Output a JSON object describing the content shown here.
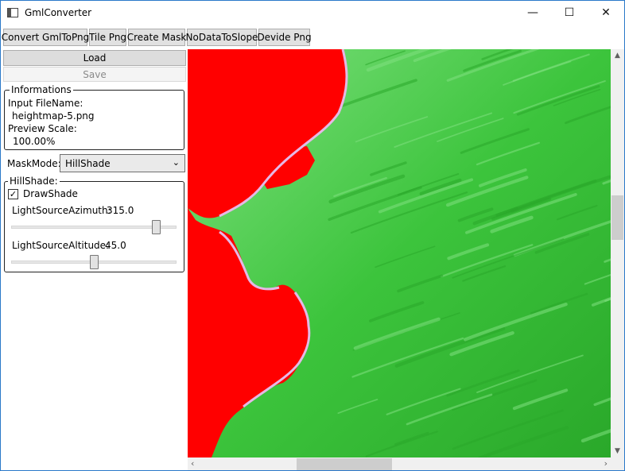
{
  "window": {
    "title": "GmlConverter",
    "controls": {
      "minimize": "—",
      "maximize": "☐",
      "close": "✕"
    }
  },
  "toolbar": {
    "buttons": [
      "Convert GmlToPng",
      "Tile Png",
      "Create Mask",
      "NoDataToSlope",
      "Devide Png"
    ]
  },
  "left": {
    "load_label": "Load",
    "save_label": "Save",
    "info": {
      "group_label": "Informations",
      "input_label": "Input FileName:",
      "input_value": "heightmap-5.png",
      "scale_label": "Preview Scale:",
      "scale_value": "100.00%"
    },
    "mask": {
      "label": "MaskMode:",
      "value": "HillShade"
    },
    "hillshade": {
      "group_label": "HillShade:",
      "draw_label": "DrawShade",
      "draw_checked": true,
      "azimuth_label": "LightSourceAzimuth:",
      "azimuth_value": "315.0",
      "azimuth_fraction": 0.875,
      "altitude_label": "LightSourceAltitude:",
      "altitude_value": "45.0",
      "altitude_fraction": 0.5
    }
  },
  "colors": {
    "water": "#ff0000",
    "land": "#3cc43c",
    "land_light": "#7fe07f",
    "land_dark": "#2aa82a",
    "highlight": "#e6b8e6"
  }
}
